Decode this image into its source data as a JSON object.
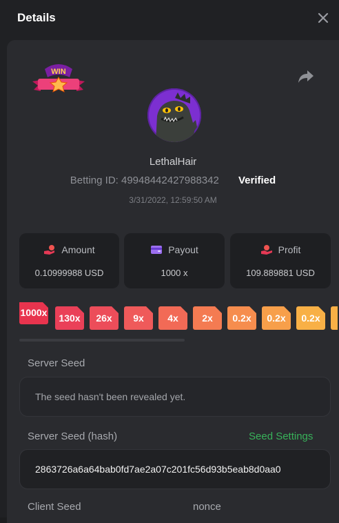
{
  "header": {
    "title": "Details",
    "close_label": "×"
  },
  "user": {
    "username": "LethalHair",
    "betting_id_label": "Betting ID:",
    "betting_id": "49948442427988342",
    "verified": "Verified",
    "datetime": "3/31/2022, 12:59:50 AM"
  },
  "badge": {
    "text": "WIN"
  },
  "stats": [
    {
      "label": "Amount",
      "value": "0.10999988 USD",
      "icon": "bet-hand-icon"
    },
    {
      "label": "Payout",
      "value": "1000 x",
      "icon": "wallet-icon"
    },
    {
      "label": "Profit",
      "value": "109.889881 USD",
      "icon": "hand-coin-icon"
    }
  ],
  "multipliers": [
    {
      "label": "1000x",
      "color": "#e8344e",
      "active": true
    },
    {
      "label": "130x",
      "color": "#ea4058"
    },
    {
      "label": "26x",
      "color": "#ec4d5a"
    },
    {
      "label": "9x",
      "color": "#ef5a5a"
    },
    {
      "label": "4x",
      "color": "#f26a56"
    },
    {
      "label": "2x",
      "color": "#f47b52"
    },
    {
      "label": "0.2x",
      "color": "#f68d4e"
    },
    {
      "label": "0.2x",
      "color": "#f79f4a"
    },
    {
      "label": "0.2x",
      "color": "#f8b046"
    },
    {
      "label": "",
      "color": "#f8b046"
    }
  ],
  "server_seed": {
    "label": "Server Seed",
    "value": "The seed hasn't been revealed yet."
  },
  "server_seed_hash": {
    "label": "Server Seed (hash)",
    "settings_link": "Seed Settings",
    "value": "2863726a6a64bab0fd7ae2a07c201fc56d93b5eab8d0aa0"
  },
  "client_seed": {
    "label": "Client Seed",
    "nonce_label": "nonce"
  },
  "colors": {
    "accent_green": "#38b25a",
    "avatar_bg": "#7c2fd1"
  }
}
